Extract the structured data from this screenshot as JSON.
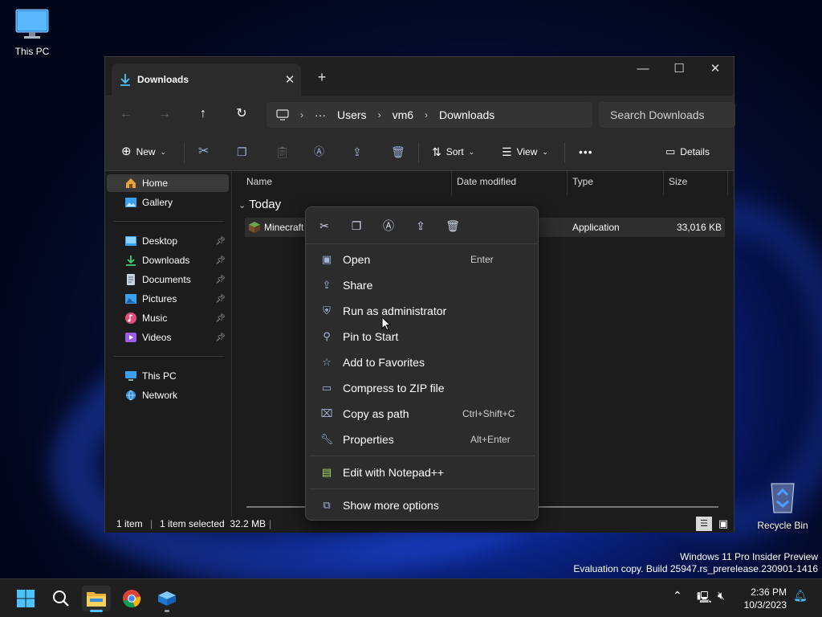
{
  "desktop": {
    "icons": [
      {
        "label": "This PC"
      },
      {
        "label": "Recycle Bin"
      }
    ],
    "watermark_line1": "Windows 11 Pro Insider Preview",
    "watermark_line2": "Evaluation copy. Build 25947.rs_prerelease.230901-1416"
  },
  "explorer": {
    "tab_title": "Downloads",
    "address": {
      "items": [
        "Users",
        "vm6",
        "Downloads"
      ],
      "ellipsis": "···"
    },
    "search_placeholder": "Search Downloads",
    "toolbar": {
      "new_label": "New",
      "sort_label": "Sort",
      "view_label": "View",
      "details_label": "Details",
      "more": "•••"
    },
    "sidebar": {
      "items": [
        {
          "label": "Home",
          "icon": "home-icon",
          "selected": true
        },
        {
          "label": "Gallery",
          "icon": "gallery-icon"
        },
        {
          "label": "Desktop",
          "icon": "desktop-icon",
          "pinned": true
        },
        {
          "label": "Downloads",
          "icon": "download-icon",
          "pinned": true
        },
        {
          "label": "Documents",
          "icon": "documents-icon",
          "pinned": true
        },
        {
          "label": "Pictures",
          "icon": "pictures-icon",
          "pinned": true
        },
        {
          "label": "Music",
          "icon": "music-icon",
          "pinned": true
        },
        {
          "label": "Videos",
          "icon": "videos-icon",
          "pinned": true
        },
        {
          "label": "This PC",
          "icon": "this-pc-icon"
        },
        {
          "label": "Network",
          "icon": "network-icon"
        }
      ]
    },
    "columns": [
      "Name",
      "Date modified",
      "Type",
      "Size"
    ],
    "group_label": "Today",
    "file": {
      "name": "Minecraft",
      "type": "Application",
      "size": "33,016 KB"
    },
    "status": {
      "items": "1 item",
      "selected": "1 item selected  32.2 MB"
    }
  },
  "context_menu": {
    "items": [
      {
        "label": "Open",
        "shortcut": "Enter",
        "icon": "open-icon"
      },
      {
        "label": "Share",
        "shortcut": "",
        "icon": "share-icon"
      },
      {
        "label": "Run as administrator",
        "shortcut": "",
        "icon": "shield-icon"
      },
      {
        "label": "Pin to Start",
        "shortcut": "",
        "icon": "pin-icon"
      },
      {
        "label": "Add to Favorites",
        "shortcut": "",
        "icon": "star-icon"
      },
      {
        "label": "Compress to ZIP file",
        "shortcut": "",
        "icon": "zip-icon"
      },
      {
        "label": "Copy as path",
        "shortcut": "Ctrl+Shift+C",
        "icon": "copy-path-icon"
      },
      {
        "label": "Properties",
        "shortcut": "Alt+Enter",
        "icon": "wrench-icon"
      },
      {
        "label": "Edit with Notepad++",
        "shortcut": "",
        "icon": "notepad-icon"
      },
      {
        "label": "Show more options",
        "shortcut": "",
        "icon": "more-options-icon"
      }
    ]
  },
  "taskbar": {
    "time": "2:36 PM",
    "date": "10/3/2023"
  },
  "colors": {
    "accent": "#4cc2ff",
    "window_bg": "#1c1c1c",
    "menu_bg": "#2c2c2c"
  }
}
